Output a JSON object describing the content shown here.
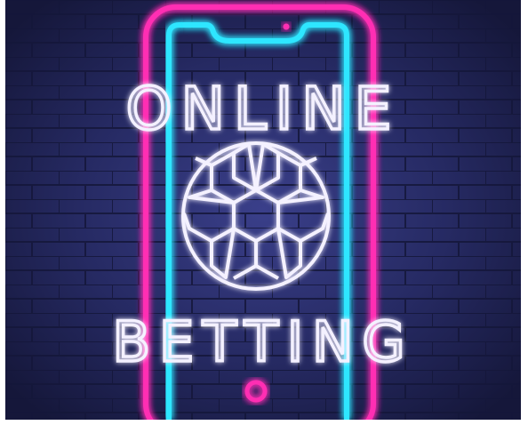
{
  "image": {
    "headline_top": "ONLINE",
    "headline_bottom": "BETTING",
    "icons": [
      "smartphone-icon",
      "soccer-ball-icon",
      "home-button-icon"
    ],
    "colors": {
      "background": "#1d1f47",
      "brick_line": "#14163a",
      "neon_pink": "#ff2fb3",
      "neon_cyan": "#2ee6ff",
      "neon_red": "#ff3a6e",
      "neon_white": "#f4f1ff"
    }
  }
}
